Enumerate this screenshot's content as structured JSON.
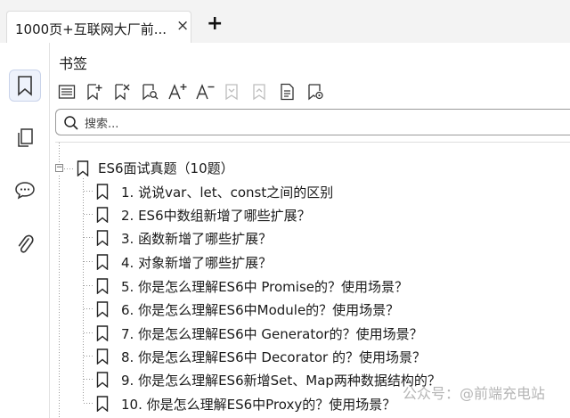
{
  "tab": {
    "title": "1000页+互联网大厂前...",
    "close_glyph": "×",
    "new_tab_glyph": "+"
  },
  "rail": {
    "items": [
      "bookmark-icon",
      "pages-icon",
      "comment-icon",
      "attachment-icon"
    ]
  },
  "panel": {
    "title": "书签",
    "toolbar": [
      "list-icon",
      "add-bookmark-icon",
      "delete-bookmark-icon",
      "find-bookmark-icon",
      "increase-font-icon",
      "decrease-font-icon",
      "expand-icon",
      "collapse-icon",
      "bookmark-properties-icon",
      "bookmark-settings-icon"
    ],
    "search_placeholder": "搜索..."
  },
  "tree": {
    "root": "ES6面试真题（10题）",
    "items": [
      "1. 说说var、let、const之间的区别",
      "2. ES6中数组新增了哪些扩展？",
      "3. 函数新增了哪些扩展？",
      "4. 对象新增了哪些扩展？",
      "5. 你是怎么理解ES6中 Promise的？使用场景？",
      "6. 你是怎么理解ES6中Module的？使用场景？",
      "7. 你是怎么理解ES6中 Generator的？使用场景？",
      "8. 你是怎么理解ES6中 Decorator 的？使用场景？",
      "9. 你是怎么理解ES6新增Set、Map两种数据结构的？",
      "10. 你是怎么理解ES6中Proxy的？使用场景？"
    ]
  },
  "watermark": "公众号：@前端充电站"
}
